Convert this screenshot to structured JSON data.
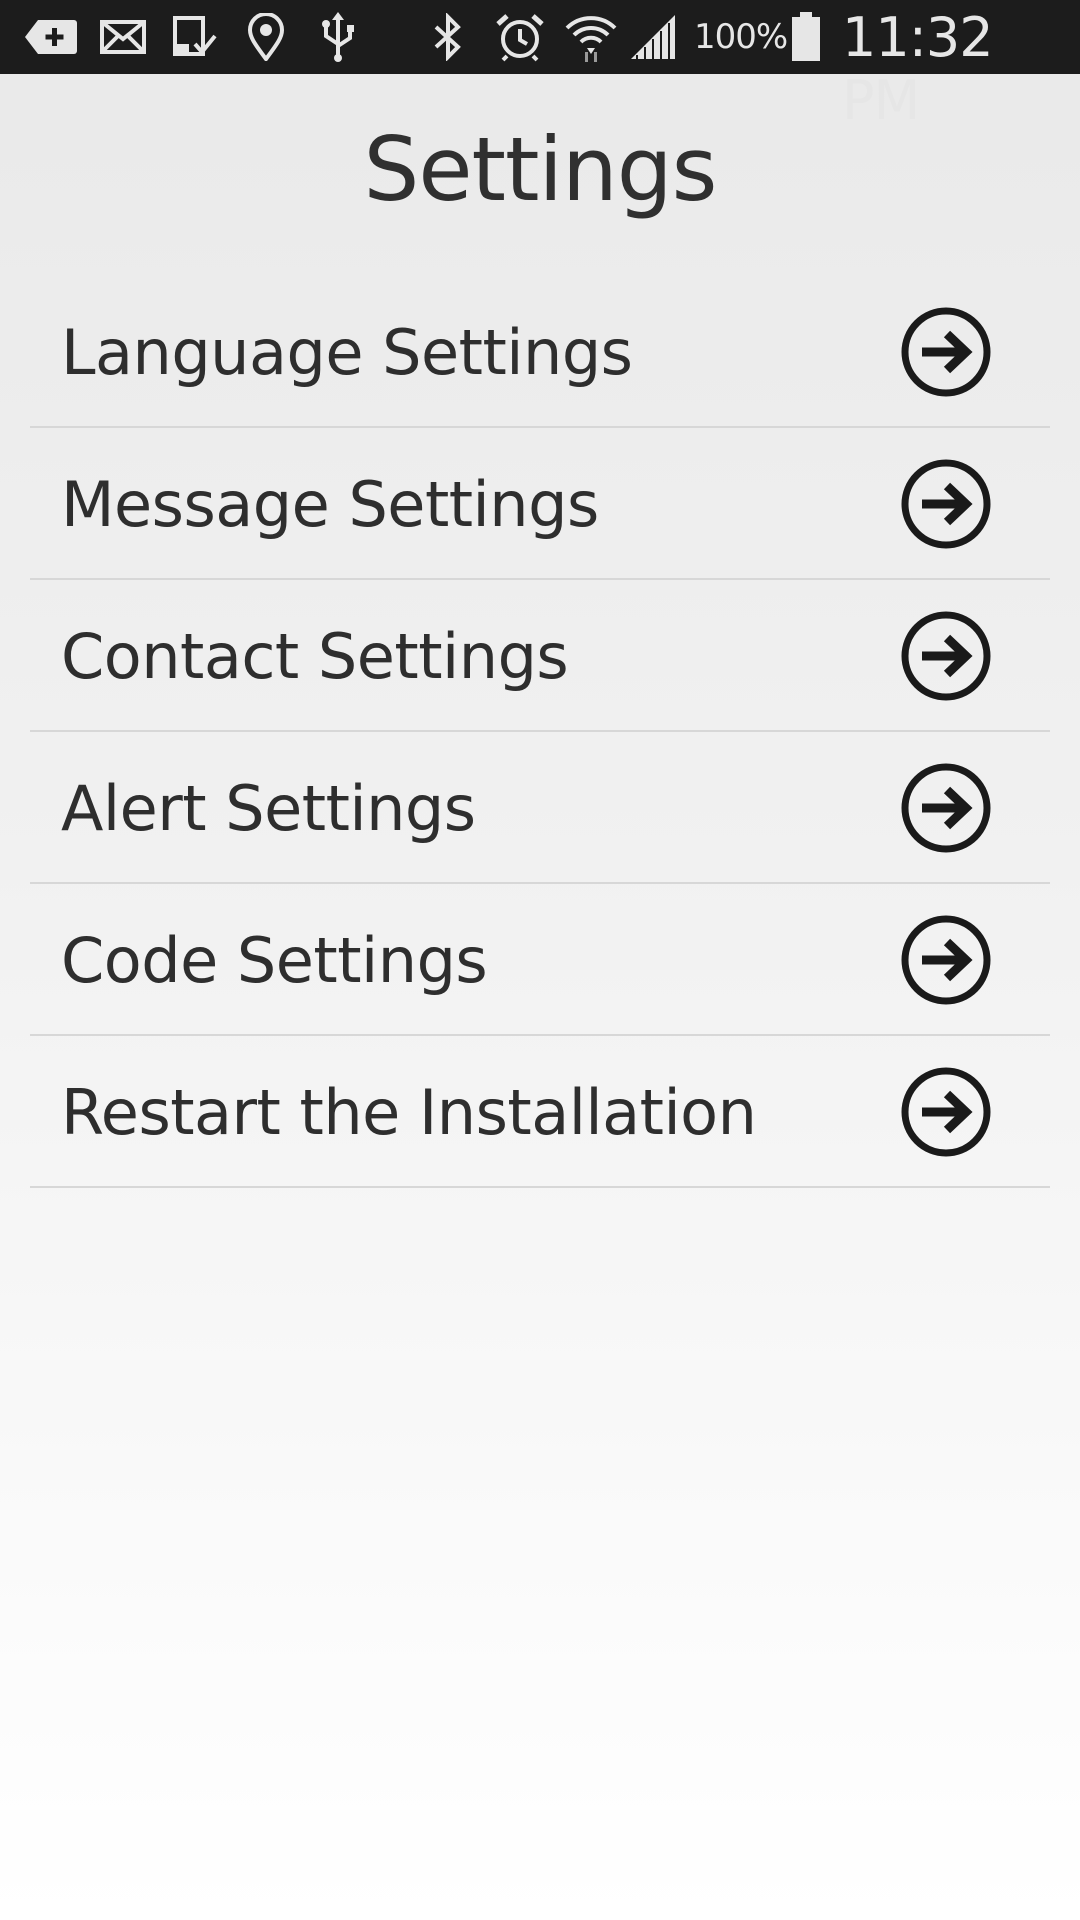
{
  "status_bar": {
    "icons": [
      "add-box-icon",
      "mail-icon",
      "download-icon",
      "location-pin-icon",
      "usb-icon",
      "bluetooth-icon",
      "alarm-icon",
      "wifi-icon",
      "signal-icon",
      "battery-icon"
    ],
    "battery_percent": "100%",
    "time": "11:32 PM"
  },
  "page": {
    "title": "Settings"
  },
  "settings": {
    "items": [
      {
        "label": "Language Settings",
        "icon": "arrow-circle-right-icon"
      },
      {
        "label": "Message Settings",
        "icon": "arrow-circle-right-icon"
      },
      {
        "label": "Contact Settings",
        "icon": "arrow-circle-right-icon"
      },
      {
        "label": "Alert Settings",
        "icon": "arrow-circle-right-icon"
      },
      {
        "label": "Code Settings",
        "icon": "arrow-circle-right-icon"
      },
      {
        "label": "Restart the Installation",
        "icon": "arrow-circle-right-icon"
      }
    ]
  },
  "colors": {
    "status_bar_bg": "#1c1c1c",
    "text": "#2e2e2e",
    "divider": "#d7d7d7",
    "icon": "#1a1a1a"
  }
}
